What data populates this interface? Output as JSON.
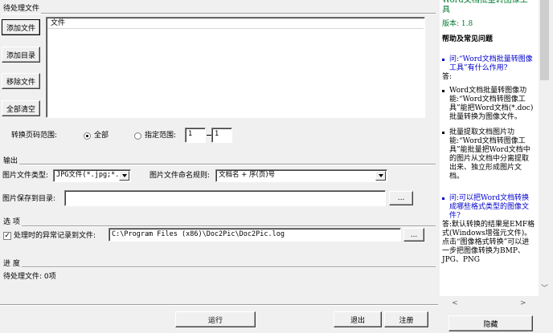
{
  "pending": {
    "group_label": "待处理文件",
    "add_file": "添加文件",
    "add_dir": "添加目录",
    "remove_file": "移除文件",
    "clear_all": "全部清空",
    "column_file": "文件",
    "range_label": "转换页码范围:",
    "range_all": "全部",
    "range_specified": "指定范围:",
    "range_from": "1",
    "range_to": "1",
    "range_selected": "全部"
  },
  "output": {
    "group_label": "输出",
    "image_type_label": "图片文件类型:",
    "image_type_value": "JPG文件(*.jpg;*.",
    "naming_label": "图片文件命名规则:",
    "naming_value": "文档名 + 序(页)号",
    "save_dir_label": "图片保存到目录:",
    "save_dir_value": "",
    "browse": "..."
  },
  "options": {
    "group_label": "选 项",
    "log_checkbox_label": "处理时的异常记录到文件:",
    "log_checked": true,
    "log_path": "C:\\Program Files (x86)\\Doc2Pic\\Doc2Pic.log",
    "browse": "..."
  },
  "progress": {
    "group_label": "进 度",
    "status_text": "待处理文件: 0项"
  },
  "bottom": {
    "run": "运行",
    "exit": "退出",
    "register": "注册"
  },
  "help": {
    "title": "Word文档批量转图像工具",
    "version_label": "版本:",
    "version_value": "1.8",
    "faq_heading": "帮助及常见问题",
    "items": [
      {
        "kind": "q",
        "text": "问:“Word文档批量转图像工具”有什么作用?"
      },
      {
        "kind": "a",
        "text": "答:"
      },
      {
        "kind": "a-item",
        "text": "Word文档批量转图像功能:“Word文档转图像工具”能把Word文档(*.doc)批量转换为图像文件。"
      },
      {
        "kind": "a-item",
        "text": "批量提取文档图片功能:“Word文档转图像工具”能批量把Word文档中的图片从文档中分离提取出来、独立形成图片文档。"
      },
      {
        "kind": "q",
        "text": "问:可以把Word文档转换成哪些格式类型的图像文件?"
      },
      {
        "kind": "a",
        "text": "答:默认转换的结果是EMF格式(Windows增强元文件)。点击“图像格式转换”可以进一步把图像转换为BMP、JPG、PNG"
      }
    ],
    "hide_button": "隐藏"
  },
  "colors": {
    "window_bg": "#f0f0f0",
    "title_green": "#007a2f",
    "link_blue": "#0000cc"
  }
}
